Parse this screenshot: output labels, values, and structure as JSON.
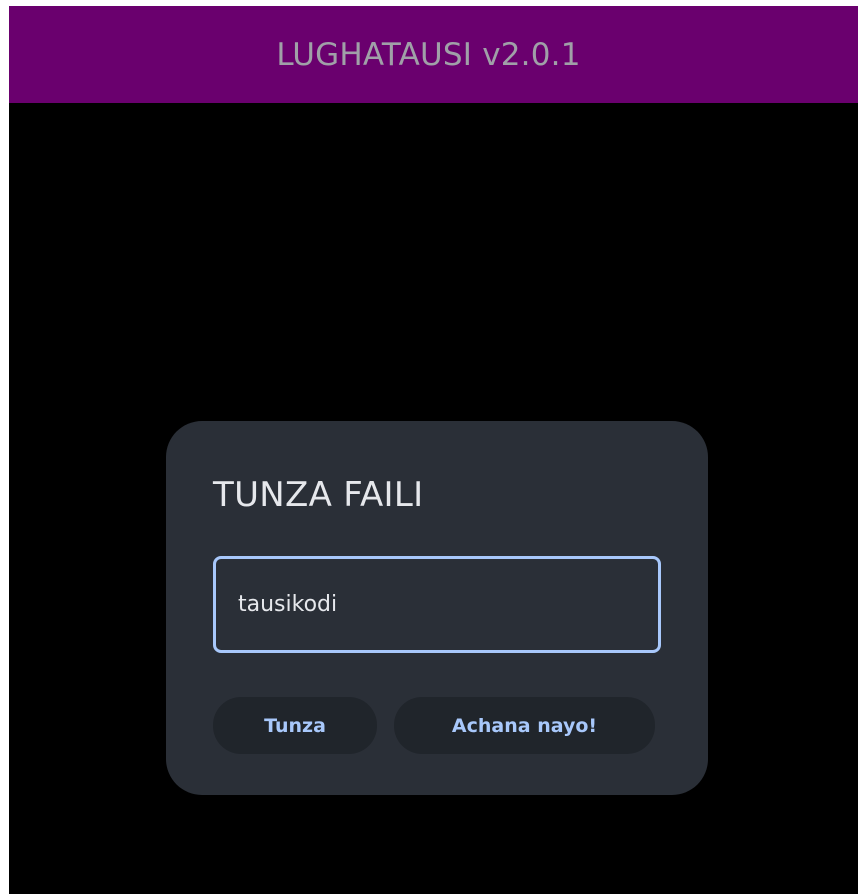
{
  "app": {
    "title": "LUGHATAUSI v2.0.1"
  },
  "dialog": {
    "title": "TUNZA FAILI",
    "filename_value": "tausikodi",
    "save_label": "Tunza",
    "cancel_label": "Achana nayo!"
  },
  "colors": {
    "title_bar": "#6a006e",
    "background": "#000000",
    "dialog": "#2a2f37",
    "accent": "#a8c8fb"
  }
}
